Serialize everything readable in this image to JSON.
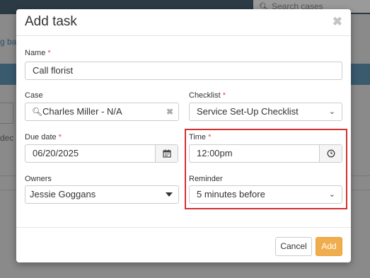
{
  "background": {
    "search_placeholder": "Search cases",
    "link_text": "g bal",
    "row_text": "dec"
  },
  "modal": {
    "title": "Add task",
    "name": {
      "label": "Name",
      "required": "*",
      "value": "Call florist"
    },
    "case": {
      "label": "Case",
      "value": "Charles Miller - N/A"
    },
    "checklist": {
      "label": "Checklist",
      "required": "*",
      "value": "Service Set-Up Checklist"
    },
    "due_date": {
      "label": "Due date",
      "required": "*",
      "value": "06/20/2025"
    },
    "time": {
      "label": "Time",
      "required": "*",
      "value": "12:00pm"
    },
    "owners": {
      "label": "Owners",
      "value": "Jessie Goggans"
    },
    "reminder": {
      "label": "Reminder",
      "value": "5 minutes before"
    },
    "buttons": {
      "cancel": "Cancel",
      "add": "Add"
    }
  },
  "colors": {
    "add_button": "#f0ad4e",
    "required_star": "#d9534f",
    "highlight_box": "#d32f2f"
  },
  "icons": [
    "search-icon",
    "close-icon",
    "calendar-icon",
    "clock-icon",
    "chevron-down-icon",
    "clear-icon",
    "caret-down-icon"
  ]
}
